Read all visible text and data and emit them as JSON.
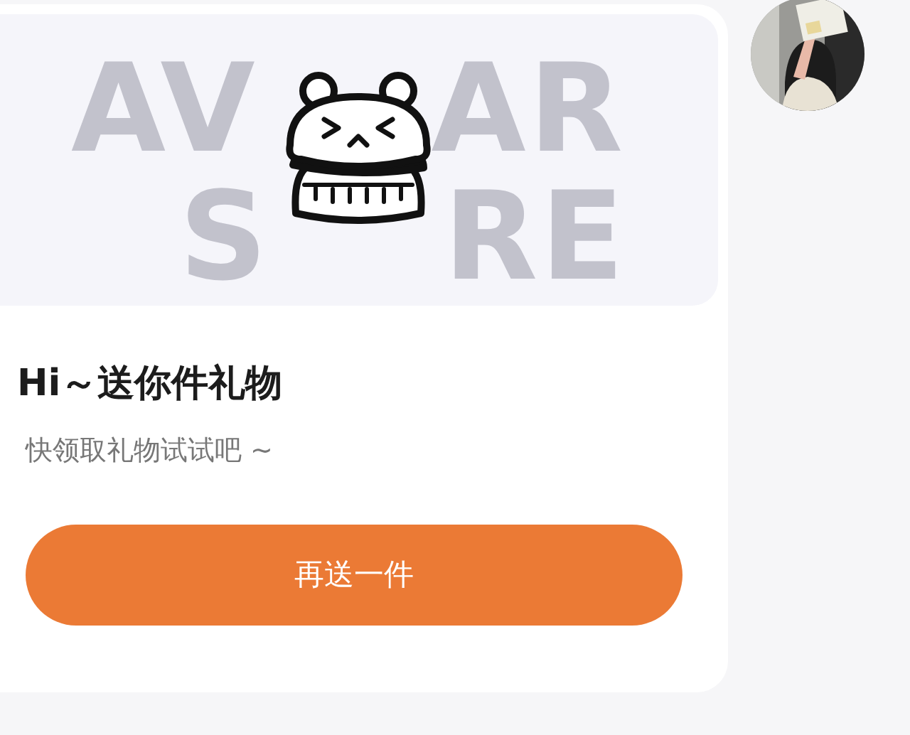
{
  "banner": {
    "backdrop_lines": [
      [
        "AV",
        "AR"
      ],
      [
        "S",
        "RE"
      ]
    ]
  },
  "card": {
    "title": "Hi～送你件礼物",
    "subtitle": "快领取礼物试试吧 ~",
    "button": "再送一件"
  }
}
